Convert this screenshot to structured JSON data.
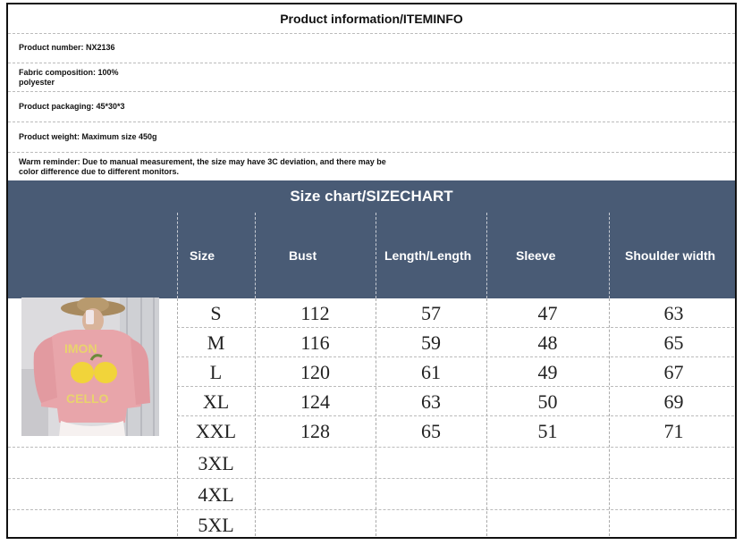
{
  "info": {
    "title": "Product information/ITEMINFO",
    "product_number": "Product number: NX2136",
    "fabric_line1": "Fabric composition: 100%",
    "fabric_line2": "polyester",
    "packaging": "Product packaging: 45*30*3",
    "weight": "Product weight: Maximum size 450g",
    "reminder_line1": "Warm reminder: Due to manual measurement, the size may have 3C deviation, and there may be",
    "reminder_line2": "color difference due to different monitors."
  },
  "size_chart": {
    "title": "Size chart/SIZECHART",
    "headers": [
      "Size",
      "Bust",
      "Length/Length",
      "Sleeve",
      "Shoulder width"
    ],
    "rows": [
      {
        "size": "S",
        "bust": "112",
        "length": "57",
        "sleeve": "47",
        "shoulder": "63"
      },
      {
        "size": "M",
        "bust": "116",
        "length": "59",
        "sleeve": "48",
        "shoulder": "65"
      },
      {
        "size": "L",
        "bust": "120",
        "length": "61",
        "sleeve": "49",
        "shoulder": "67"
      },
      {
        "size": "XL",
        "bust": "124",
        "length": "63",
        "sleeve": "50",
        "shoulder": "69"
      },
      {
        "size": "XXL",
        "bust": "128",
        "length": "65",
        "sleeve": "51",
        "shoulder": "71"
      },
      {
        "size": "3XL",
        "bust": "",
        "length": "",
        "sleeve": "",
        "shoulder": ""
      },
      {
        "size": "4XL",
        "bust": "",
        "length": "",
        "sleeve": "",
        "shoulder": ""
      },
      {
        "size": "5XL",
        "bust": "",
        "length": "",
        "sleeve": "",
        "shoulder": ""
      }
    ]
  },
  "colors": {
    "header_bg": "#495b75",
    "header_text": "#ffffff",
    "border": "#111111"
  },
  "photo": {
    "description_icon": "product-photo",
    "sweater_text_1": "IMON",
    "sweater_text_2": "CELLO"
  }
}
